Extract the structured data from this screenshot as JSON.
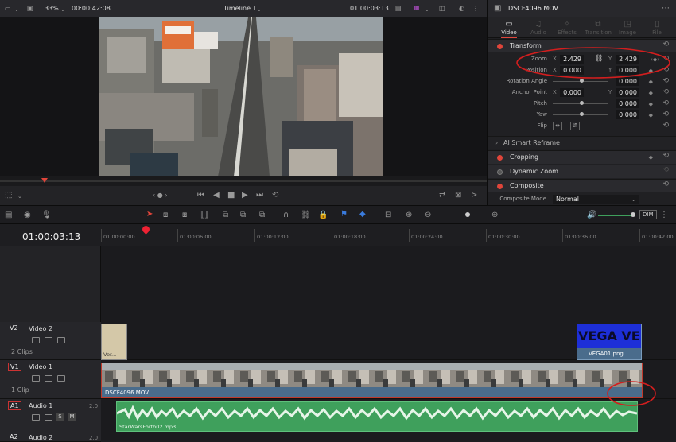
{
  "viewer": {
    "zoom": "33%",
    "source_timecode": "00:00:42:08",
    "timeline_name": "Timeline 1",
    "timecode": "01:00:03:13"
  },
  "inspector": {
    "clip_name": "DSCF4096.MOV",
    "tabs": [
      {
        "label": "Video",
        "icon": "video-icon",
        "active": true
      },
      {
        "label": "Audio",
        "icon": "audio-icon",
        "active": false
      },
      {
        "label": "Effects",
        "icon": "effects-icon",
        "active": false
      },
      {
        "label": "Transition",
        "icon": "transition-icon",
        "active": false
      },
      {
        "label": "Image",
        "icon": "image-icon",
        "active": false
      },
      {
        "label": "File",
        "icon": "file-icon",
        "active": false
      }
    ],
    "transform": {
      "title": "Transform",
      "zoom_label": "Zoom",
      "zoom_x": "2.429",
      "zoom_y": "2.429",
      "position_label": "Position",
      "position_x": "0.000",
      "position_y": "0.000",
      "rotation_label": "Rotation Angle",
      "rotation": "0.000",
      "anchor_label": "Anchor Point",
      "anchor_x": "0.000",
      "anchor_y": "0.000",
      "pitch_label": "Pitch",
      "pitch": "0.000",
      "yaw_label": "Yaw",
      "yaw": "0.000",
      "flip_label": "Flip",
      "x_axis": "X",
      "y_axis": "Y"
    },
    "sections": {
      "smart_reframe": "AI Smart Reframe",
      "cropping": "Cropping",
      "dynamic_zoom": "Dynamic Zoom",
      "composite": "Composite",
      "composite_mode_label": "Composite Mode",
      "composite_mode_value": "Normal"
    }
  },
  "timeline": {
    "timecode": "01:00:03:13",
    "ruler": [
      "01:00:00:00",
      "01:00:06:00",
      "01:00:12:00",
      "01:00:18:00",
      "01:00:24:00",
      "01:00:30:00",
      "01:00:36:00",
      "01:00:42:00"
    ],
    "dim_label": "DIM",
    "tracks": {
      "v2": {
        "id": "V2",
        "name": "Video 2",
        "clips": "2 Clips"
      },
      "v1": {
        "id": "V1",
        "name": "Video 1",
        "clips": "1 Clip"
      },
      "a1": {
        "id": "A1",
        "name": "Audio 1",
        "level": "2.0",
        "s": "S",
        "m": "M"
      },
      "a2": {
        "id": "A2",
        "name": "Audio 2",
        "level": "2.0"
      }
    },
    "clips": {
      "v2_first": "Ver...",
      "v2_second": "VEGA01.png",
      "v2_graphic_text": "VEGA VE",
      "v1_clip": "DSCF4096.MOV",
      "a1_clip": "StarWarsForth02.mp3"
    }
  },
  "colors": {
    "accent_red": "#e0453a",
    "video_clip_blue": "#4a6c8c",
    "audio_green": "#3fa05c",
    "annotation_red": "#d21e1e"
  }
}
